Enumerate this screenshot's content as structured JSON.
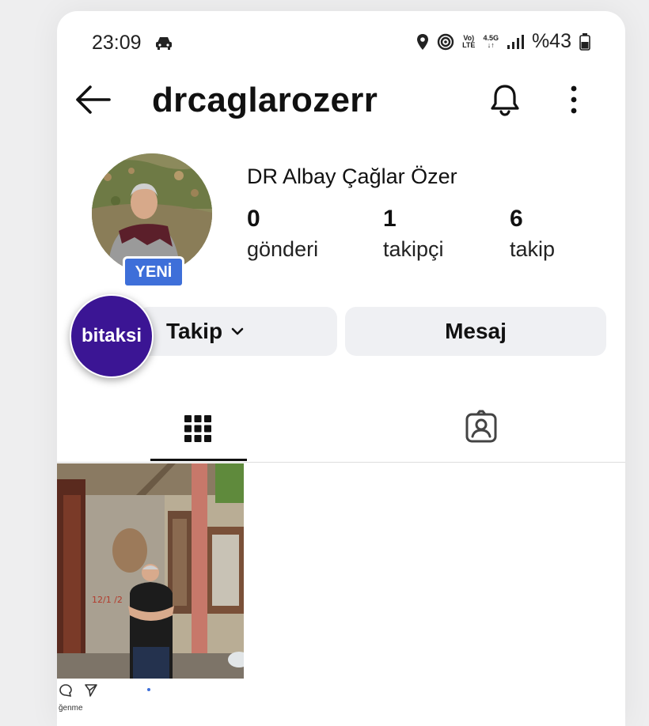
{
  "status_bar": {
    "time": "23:09",
    "net_top": "Vo)",
    "net_bottom": "LTE",
    "gen_top": "4.5G",
    "gen_bottom": "↓↑",
    "battery": "%43"
  },
  "header": {
    "username": "drcaglarozerr"
  },
  "profile": {
    "full_name": "DR Albay Çağlar Özer",
    "new_badge": "YENİ",
    "stats": [
      {
        "value": "0",
        "label": "gönderi"
      },
      {
        "value": "1",
        "label": "takipçi"
      },
      {
        "value": "6",
        "label": "takip"
      }
    ]
  },
  "actions": {
    "follow_label": "Takip",
    "message_label": "Mesaj"
  },
  "overlay": {
    "bitaksi_label": "bitaksi"
  },
  "post": {
    "sign_text": "12/1 /2",
    "caption_fragment": "ğenme"
  },
  "colors": {
    "accent_blue": "#3e6fd9",
    "button_bg": "#eff0f3",
    "bitaksi_purple": "#3b1594"
  }
}
